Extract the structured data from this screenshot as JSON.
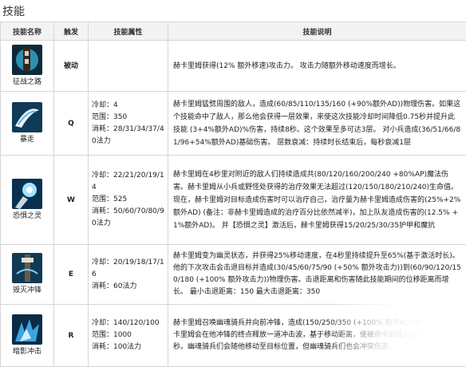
{
  "page_title": "技能",
  "headers": {
    "name": "技能名称",
    "trigger": "触发",
    "attributes": "技能属性",
    "description": "技能说明"
  },
  "skills": [
    {
      "name": "征战之路",
      "trigger": "被动",
      "attributes": [],
      "description": "赫卡里姆获得(12% 额外移速)攻击力。 攻击力随额外移动速度而增长。",
      "icon": "passive-rider-icon"
    },
    {
      "name": "暴走",
      "trigger": "Q",
      "attributes": [
        "冷却：4",
        "范围：350",
        "消耗：28/31/34/37/4",
        "0法力"
      ],
      "description": "赫卡里姆猛劈周围的敌人，造成(60/85/110/135/160 (+90%额外AD))物理伤害。如果这个技能命中了敌人，那么他会获得一层效果，来使这次技能冷却时间降低0.75秒并提升此技能 (3+4%额外AD)%伤害，持续8秒。这个效果至多可达3层。 对小兵造成(36/51/66/81/96+54%额外AD)基础伤害。 层数衰减：持续时长结束后，每秒衰减1层",
      "icon": "rampage-icon"
    },
    {
      "name": "恐惧之灵",
      "trigger": "W",
      "attributes": [
        "冷却：22/21/20/19/1",
        "4",
        "范围：525",
        "消耗：50/60/70/80/9",
        "0法力"
      ],
      "description": "赫卡里姆在4秒里对附近的敌人们持续造成共(80/120/160/200/240 +80%AP)魔法伤害。赫卡里姆从小兵或野怪处获得的治疗效果无法超过(120/150/180/210/240)生命值。 现在，赫卡里姆对目标造成伤害时可以治疗自己，治疗量为赫卡里姆造成伤害的(25%+2%额外AD) (备注：非赫卡里姆造成的治疗百分比依然减半)，加上队友造成伤害的(12.5% +1%额外AD)。 并【恐惧之灵】激活后，赫卡里姆获得15/20/25/30/35护甲和魔抗",
      "icon": "spirit-of-dread-icon"
    },
    {
      "name": "毁灭冲锋",
      "trigger": "E",
      "attributes": [
        "冷却：20/19/18/17/1",
        "6",
        "消耗：60法力"
      ],
      "description": "赫卡里姆变为幽灵状态，并获得25%移动速度，在4秒里持续提升至65%(基于激活时长)。他的下次攻击会击退目标并造成(30/45/60/75/90 (+50% 额外攻击力))到(60/90/120/150/180 (+100% 额外攻击力))物理伤害。击退距离和伤害随此技能期间的位移距离而增长。 最小击退距离：150 最大击退距离：350",
      "icon": "devastating-charge-icon"
    },
    {
      "name": "暗影冲击",
      "trigger": "R",
      "attributes": [
        "冷却：140/120/100",
        "范围：1000",
        "消耗：100法力"
      ],
      "description": "赫卡里姆召唤幽魂骑兵并向前冲锋，造成(150/250/350 (+100% 额外AD))魔法伤害。赫卡里姆会在他冲锋的终点释放一道冲击波，基于移动距离，使被命中的敌人恐惧0.75到1.5秒。幽魂骑兵们会随他移动至目标位置，但幽魂骑兵们也会冲突伤害。",
      "icon": "onslaught-of-shadows-icon"
    }
  ],
  "colors": {
    "header_bg": "#f3f3f3",
    "border": "#d6d6d6",
    "icon_blue": "#1e6fb5"
  }
}
